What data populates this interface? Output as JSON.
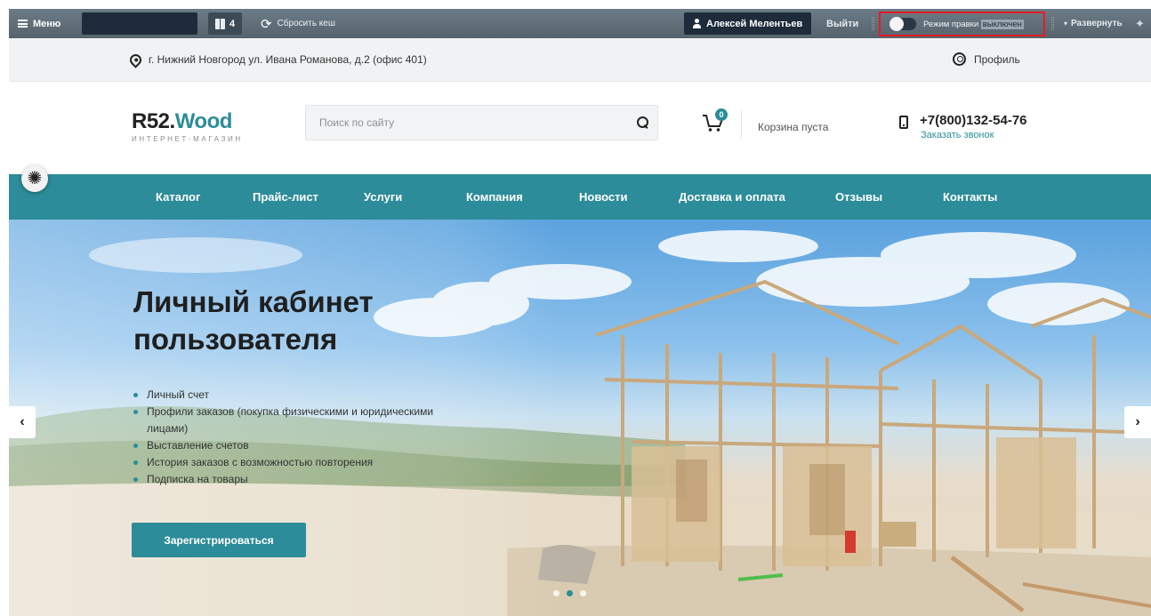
{
  "admin": {
    "menu_label": "Меню",
    "notes_count": "4",
    "cache_label": "Сбросить кеш",
    "user_name": "Алексей Мелентьев",
    "logout_label": "Выйти",
    "edit_mode_label": "Режим правки",
    "edit_mode_state": "выключен",
    "expand_label": "Развернуть"
  },
  "topline": {
    "address": "г. Нижний Новгород ул. Ивана Романова, д.2 (офис 401)",
    "profile_label": "Профиль"
  },
  "header": {
    "logo_brand": "R52.",
    "logo_brand_accent": "Wood",
    "logo_tagline": "ИНТЕРНЕТ-МАГАЗИН",
    "search_placeholder": "Поиск по сайту",
    "cart_count": "0",
    "cart_text": "Корзина пуста",
    "phone": "+7(800)132-54-76",
    "callback_label": "Заказать звонок"
  },
  "nav": {
    "items": [
      {
        "label": "Каталог"
      },
      {
        "label": "Прайс-лист"
      },
      {
        "label": "Услуги"
      },
      {
        "label": "Компания"
      },
      {
        "label": "Новости"
      },
      {
        "label": "Доставка и оплата"
      },
      {
        "label": "Отзывы"
      },
      {
        "label": "Контакты"
      }
    ]
  },
  "hero": {
    "title": "Личный кабинет пользователя",
    "features": [
      "Личный счет",
      "Профили заказов (покупка физическими и юридическими лицами)",
      "Выставление счетов",
      "История заказов с возможностью повторения",
      "Подписка на товары"
    ],
    "button_label": "Зарегистрироваться",
    "slides_total": 3,
    "active_slide": 2
  },
  "colors": {
    "accent": "#2c8c99",
    "admin_bar": "#5f6d77",
    "admin_dark": "#1e2b3a",
    "highlight": "#e51c23"
  },
  "icons": {
    "menu": "hamburger-icon",
    "notes": "book-icon",
    "cache": "refresh-icon",
    "user": "person-icon",
    "edit_toggle": "toggle-icon",
    "expand": "chevron-down-icon",
    "pin": "pin-icon",
    "address": "location-pin-icon",
    "profile": "profile-icon",
    "search": "search-icon",
    "cart": "cart-icon",
    "phone": "phone-icon",
    "settings": "gear-icon",
    "prev": "chevron-left-icon",
    "next": "chevron-right-icon"
  }
}
